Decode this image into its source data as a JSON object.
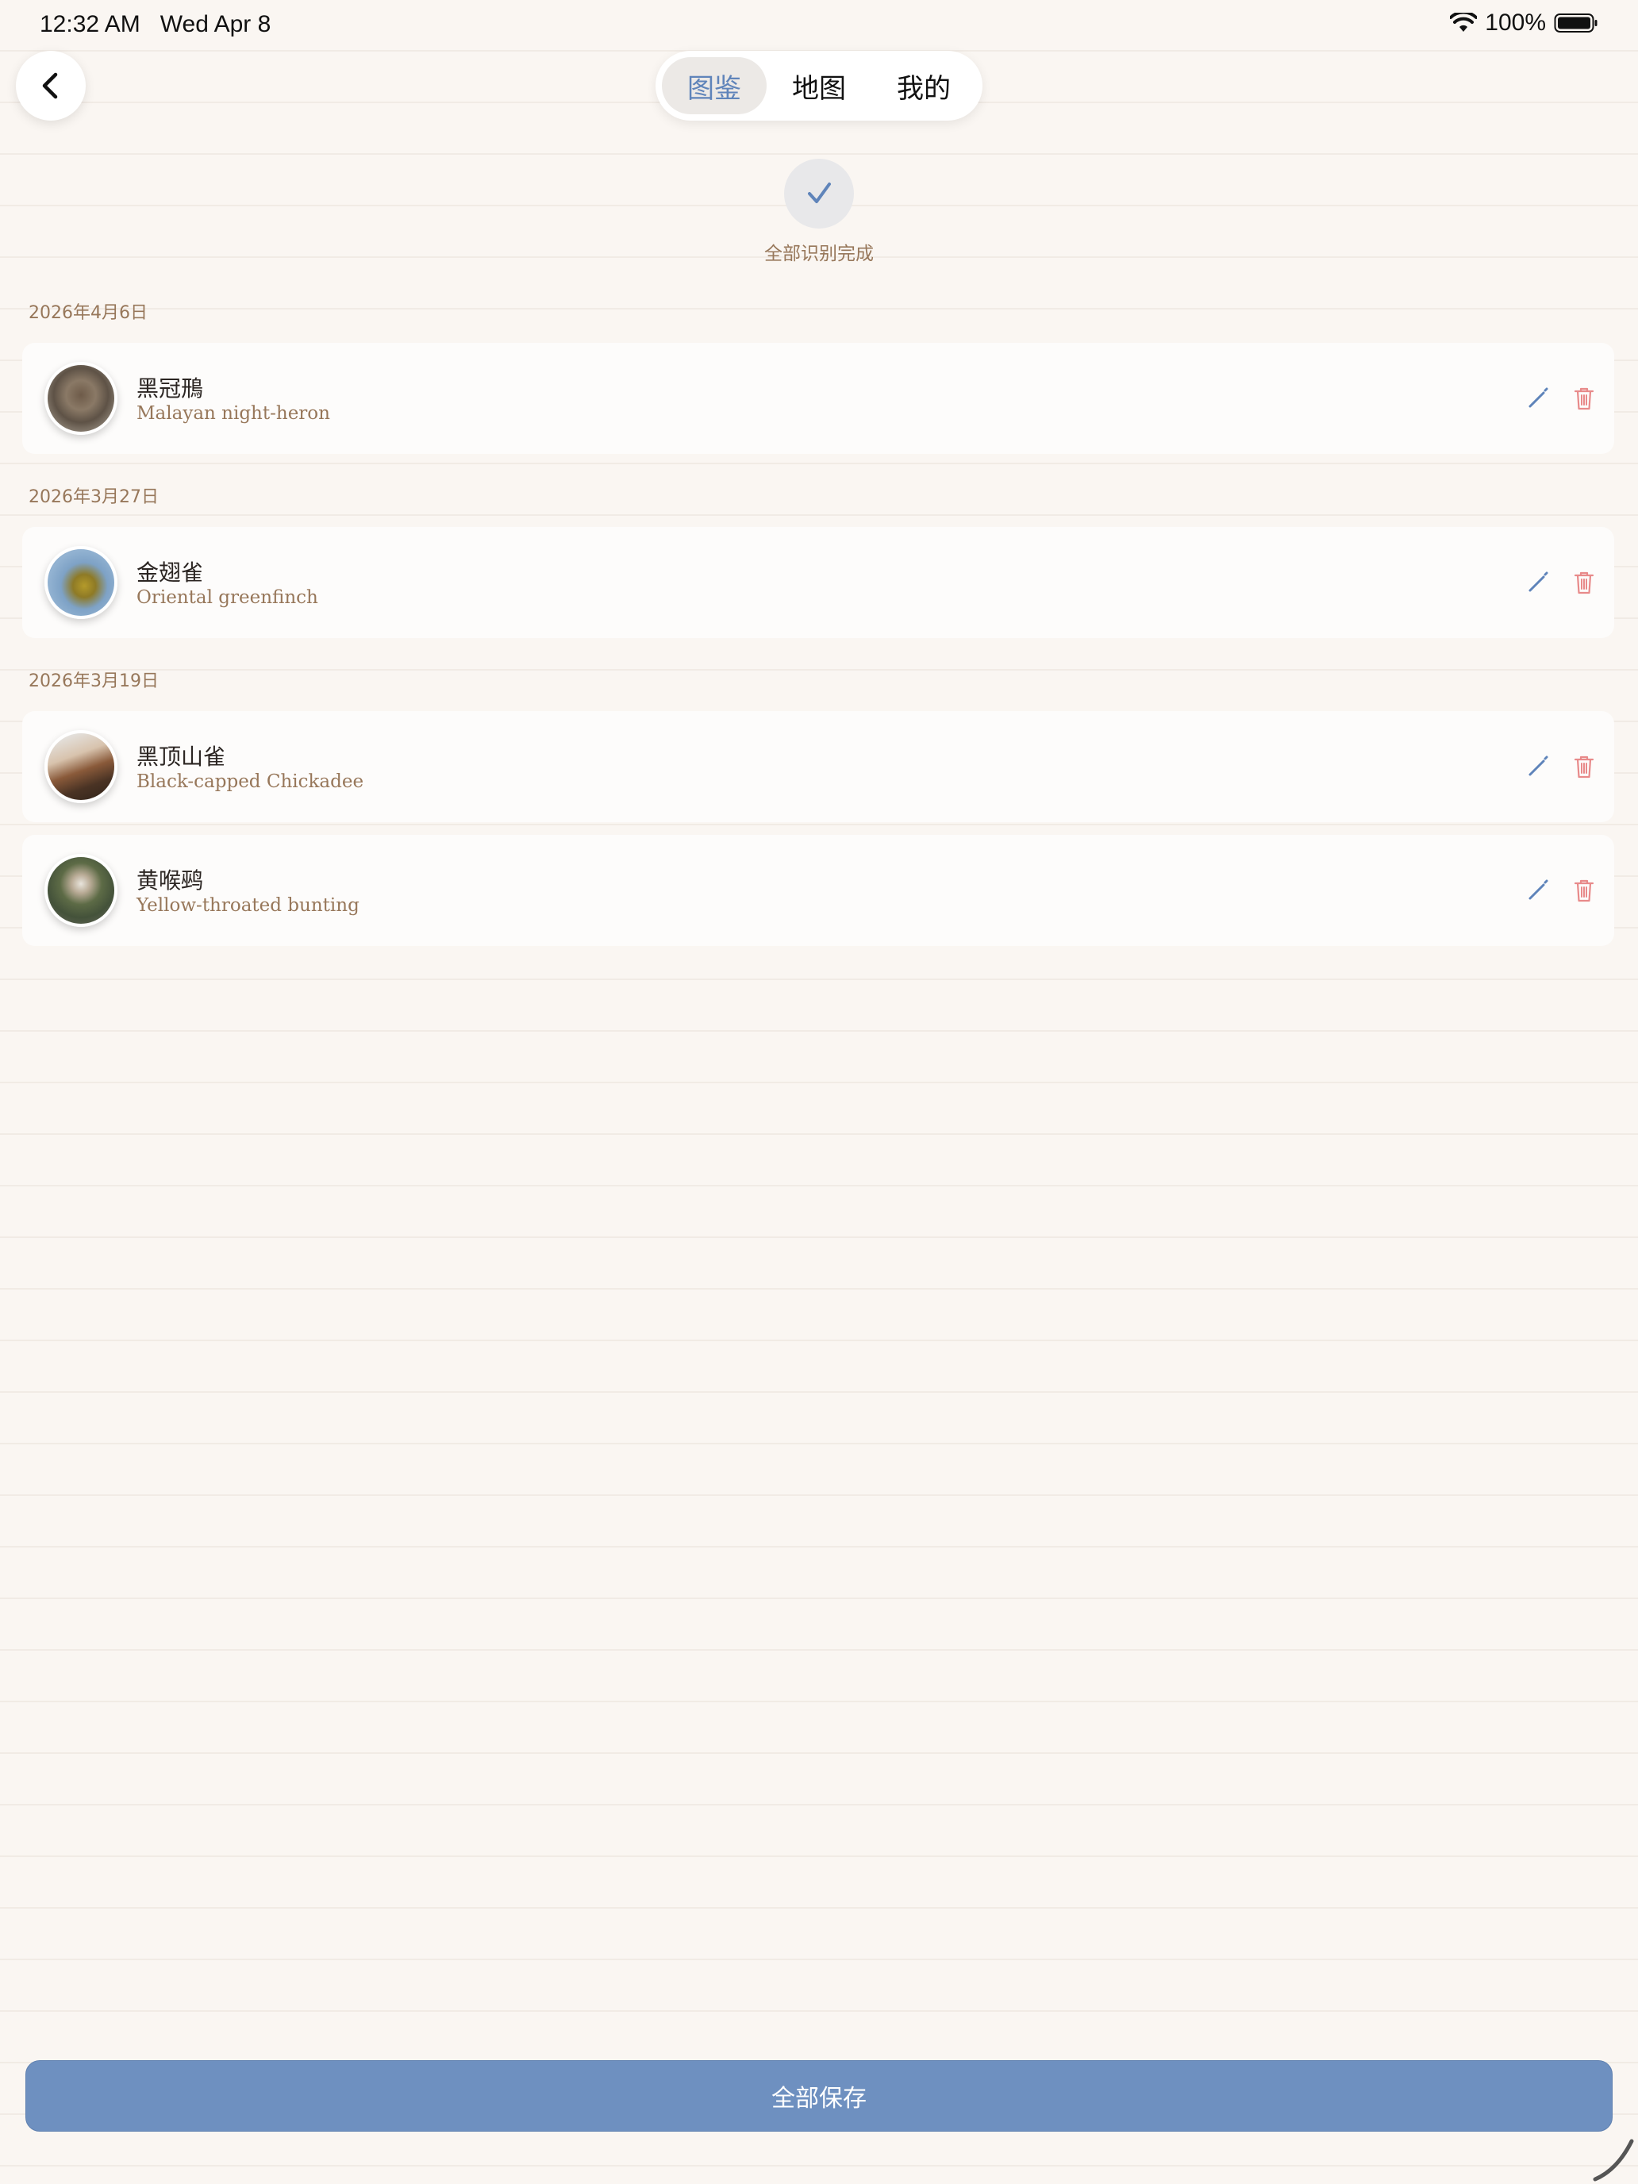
{
  "status_bar": {
    "time": "12:32 AM",
    "date": "Wed Apr 8",
    "battery": "100%"
  },
  "nav": {
    "back_icon": "chevron-left-icon",
    "tabs": [
      {
        "label": "图鉴",
        "active": true
      },
      {
        "label": "地图",
        "active": false
      },
      {
        "label": "我的",
        "active": false
      }
    ]
  },
  "status": {
    "icon": "checkmark-icon",
    "text": "全部识别完成"
  },
  "sections": [
    {
      "date": "2026年4月6日",
      "items": [
        {
          "cn": "黑冠鳽",
          "en": "Malayan night-heron"
        }
      ]
    },
    {
      "date": "2026年3月27日",
      "items": [
        {
          "cn": "金翅雀",
          "en": "Oriental greenfinch"
        }
      ]
    },
    {
      "date": "2026年3月19日",
      "items": [
        {
          "cn": "黑顶山雀",
          "en": "Black-capped Chickadee"
        },
        {
          "cn": "黄喉鹀",
          "en": "Yellow-throated bunting"
        }
      ]
    }
  ],
  "save_button": {
    "label": "全部保存"
  },
  "colors": {
    "accent": "#6e90c0",
    "active_tab_text": "#5f84ba",
    "delete": "#e88a8a",
    "muted_text": "#97775a",
    "background": "#faf6f2"
  }
}
